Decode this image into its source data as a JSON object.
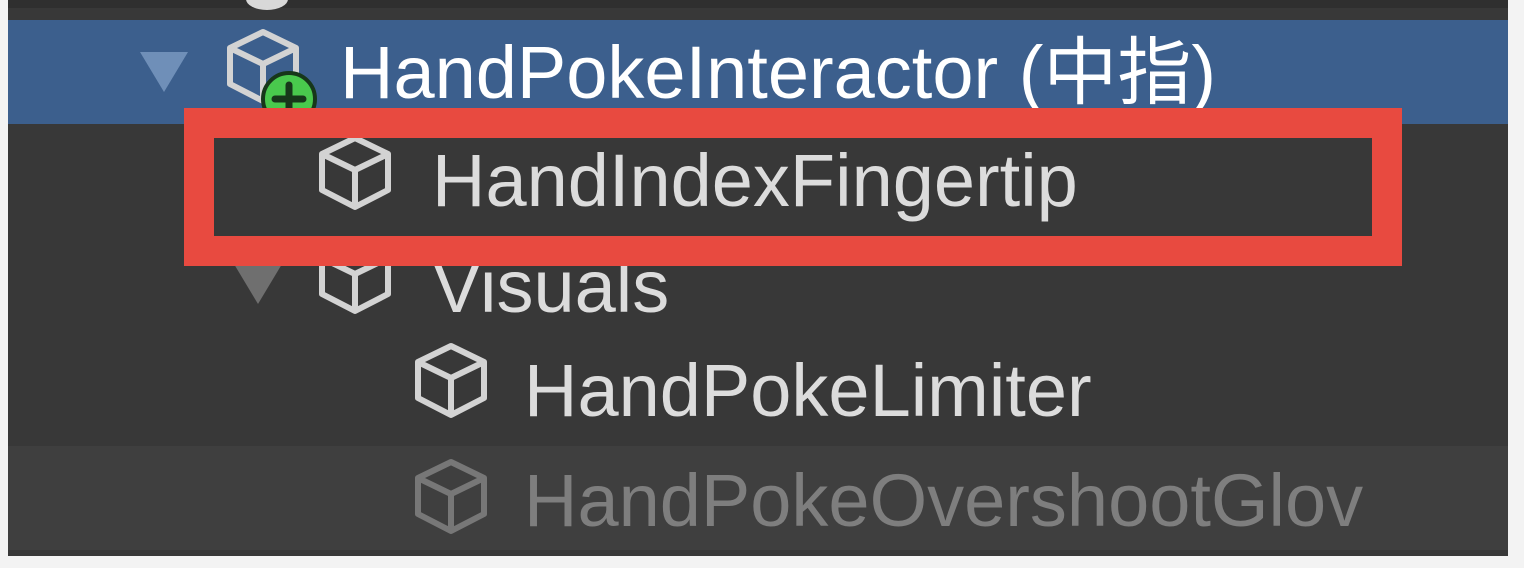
{
  "hierarchy": {
    "rows": [
      {
        "label": "HandPokeInteractor (中指)",
        "state": "selected",
        "icon": "prefab-cube-icon",
        "badge": "add-badge-icon",
        "foldout": "expanded"
      },
      {
        "label": "HandIndexFingertip",
        "state": "highlighted",
        "icon": "cube-icon"
      },
      {
        "label": "Visuals",
        "state": "normal",
        "icon": "cube-icon",
        "foldout": "expanded"
      },
      {
        "label": "HandPokeLimiter",
        "state": "normal",
        "icon": "cube-icon"
      },
      {
        "label": "HandPokeOvershootGlov",
        "state": "inactive",
        "icon": "cube-icon"
      }
    ]
  },
  "colors": {
    "background": "#383838",
    "selected": "#3c5f8d",
    "highlight_box": "#e84a40",
    "text": "#dcdcdc",
    "inactive_text": "#7e7e7e"
  }
}
